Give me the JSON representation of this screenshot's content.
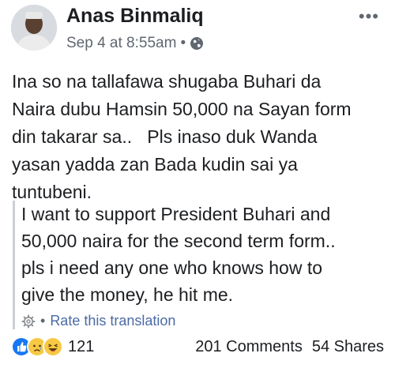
{
  "post": {
    "author": "Anas Binmaliq",
    "timestamp": "Sep 4 at 8:55am",
    "separator": "•",
    "privacy_icon": "globe-icon",
    "more_label": "•••",
    "text_lines": [
      "Ina so na tallafawa shugaba Buhari da",
      "Naira dubu Hamsin 50,000 na Sayan form",
      "din takarar sa..   Pls inaso duk Wanda",
      "yasan yadda zan Bada kudin sai ya",
      "tuntubeni."
    ],
    "translation_lines": [
      "I want to support President Buhari and",
      "50,000 naira for the second term form..",
      "pls i need any one who knows how to",
      "give the money, he hit me."
    ],
    "translation_settings_icon": "gear-icon",
    "rate_translation_label": "Rate this translation"
  },
  "footer": {
    "reaction_icons": [
      "like-icon",
      "sad-icon",
      "haha-icon"
    ],
    "reaction_count": "121",
    "comments_label": "201 Comments",
    "shares_label": "54 Shares"
  },
  "colors": {
    "like": "#1877f2",
    "emoji_yellow": "#f7c843",
    "link": "#4b6aa7",
    "muted": "#606770"
  }
}
